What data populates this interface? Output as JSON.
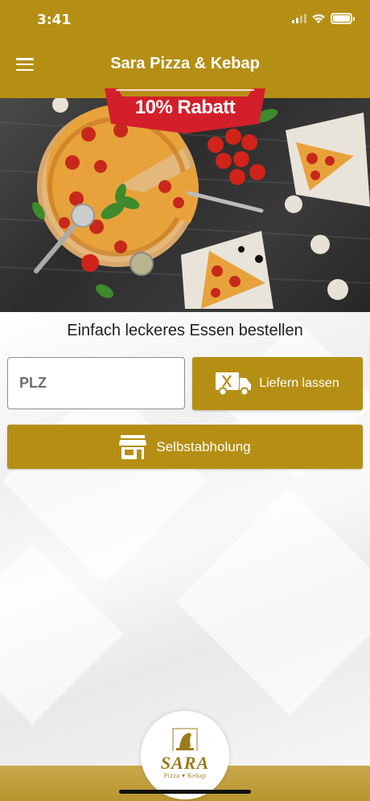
{
  "status_bar": {
    "time": "3:41"
  },
  "header": {
    "title": "Sara Pizza & Kebap"
  },
  "promo": {
    "label": "10% Rabatt"
  },
  "main": {
    "tagline": "Einfach leckeres Essen bestellen",
    "plz_placeholder": "PLZ",
    "plz_value": "",
    "deliver_label": "Liefern lassen",
    "pickup_label": "Selbstabholung"
  },
  "logo": {
    "name": "SARA",
    "subline": "Pizza ▾ Kebap"
  },
  "icons": {
    "menu": "menu-icon",
    "location": "crosshair-location-icon",
    "delivery": "delivery-truck-icon",
    "store": "store-icon",
    "wifi": "wifi-icon",
    "signal": "signal-icon",
    "battery": "battery-icon"
  },
  "colors": {
    "brand": "#b58f14",
    "ribbon": "#d31f2b",
    "text": "#222222"
  }
}
